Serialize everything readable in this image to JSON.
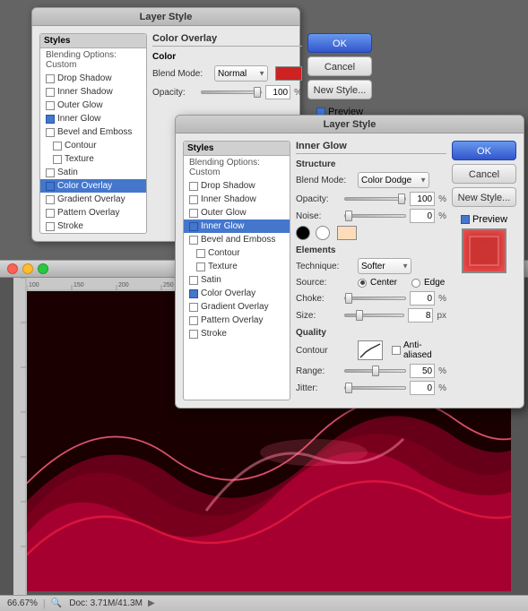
{
  "dialogs": {
    "back": {
      "title": "Layer Style",
      "section": "Color Overlay",
      "sub_section": "Color",
      "blend_mode_label": "Blend Mode:",
      "blend_mode_value": "Normal",
      "opacity_label": "Opacity:",
      "opacity_value": "100",
      "opacity_percent": "%"
    },
    "front": {
      "title": "Layer Style",
      "section": "Inner Glow",
      "structure_title": "Structure",
      "blend_mode_label": "Blend Mode:",
      "blend_mode_value": "Color Dodge",
      "opacity_label": "Opacity:",
      "opacity_value": "100",
      "opacity_percent": "%",
      "noise_label": "Noise:",
      "noise_value": "0",
      "elements_title": "Elements",
      "technique_label": "Technique:",
      "technique_value": "Softer",
      "source_label": "Source:",
      "source_center": "Center",
      "source_edge": "Edge",
      "choke_label": "Choke:",
      "choke_value": "0",
      "size_label": "Size:",
      "size_value": "8",
      "size_unit": "px",
      "quality_title": "Quality",
      "contour_label": "Contour",
      "anti_alias_label": "Anti-aliased",
      "range_label": "Range:",
      "range_value": "50",
      "jitter_label": "Jitter:",
      "jitter_value": "0",
      "percent": "%"
    },
    "buttons": {
      "ok": "OK",
      "cancel": "Cancel",
      "new_style": "New Style...",
      "preview": "Preview"
    }
  },
  "styles_back": {
    "header": "Styles",
    "blending_options": "Blending Options: Custom",
    "items": [
      {
        "label": "Drop Shadow",
        "checked": false,
        "active": false
      },
      {
        "label": "Inner Shadow",
        "checked": false,
        "active": false
      },
      {
        "label": "Outer Glow",
        "checked": false,
        "active": false
      },
      {
        "label": "Inner Glow",
        "checked": true,
        "active": false
      },
      {
        "label": "Bevel and Emboss",
        "checked": false,
        "active": false
      },
      {
        "label": "Contour",
        "checked": false,
        "active": false,
        "indent": true
      },
      {
        "label": "Texture",
        "checked": false,
        "active": false,
        "indent": true
      },
      {
        "label": "Satin",
        "checked": false,
        "active": false
      },
      {
        "label": "Color Overlay",
        "checked": true,
        "active": true
      },
      {
        "label": "Gradient Overlay",
        "checked": false,
        "active": false
      },
      {
        "label": "Pattern Overlay",
        "checked": false,
        "active": false
      },
      {
        "label": "Stroke",
        "checked": false,
        "active": false
      }
    ]
  },
  "styles_front": {
    "header": "Styles",
    "blending_options": "Blending Options: Custom",
    "items": [
      {
        "label": "Drop Shadow",
        "checked": false,
        "active": false
      },
      {
        "label": "Inner Shadow",
        "checked": false,
        "active": false
      },
      {
        "label": "Outer Glow",
        "checked": false,
        "active": false
      },
      {
        "label": "Inner Glow",
        "checked": true,
        "active": true
      },
      {
        "label": "Bevel and Emboss",
        "checked": false,
        "active": false
      },
      {
        "label": "Contour",
        "checked": false,
        "active": false,
        "indent": true
      },
      {
        "label": "Texture",
        "checked": false,
        "active": false,
        "indent": true
      },
      {
        "label": "Satin",
        "checked": false,
        "active": false
      },
      {
        "label": "Color Overlay",
        "checked": true,
        "active": false
      },
      {
        "label": "Gradient Overlay",
        "checked": false,
        "active": false
      },
      {
        "label": "Pattern Overlay",
        "checked": false,
        "active": false
      },
      {
        "label": "Stroke",
        "checked": false,
        "active": false
      }
    ]
  },
  "canvas": {
    "zoom": "66.67%",
    "doc_size": "Doc: 3.71M/41.3M",
    "title_text": ""
  },
  "statusbar": {
    "zoom_value": "66.67%",
    "doc_label": "Doc: 3.71M/41.3M"
  }
}
